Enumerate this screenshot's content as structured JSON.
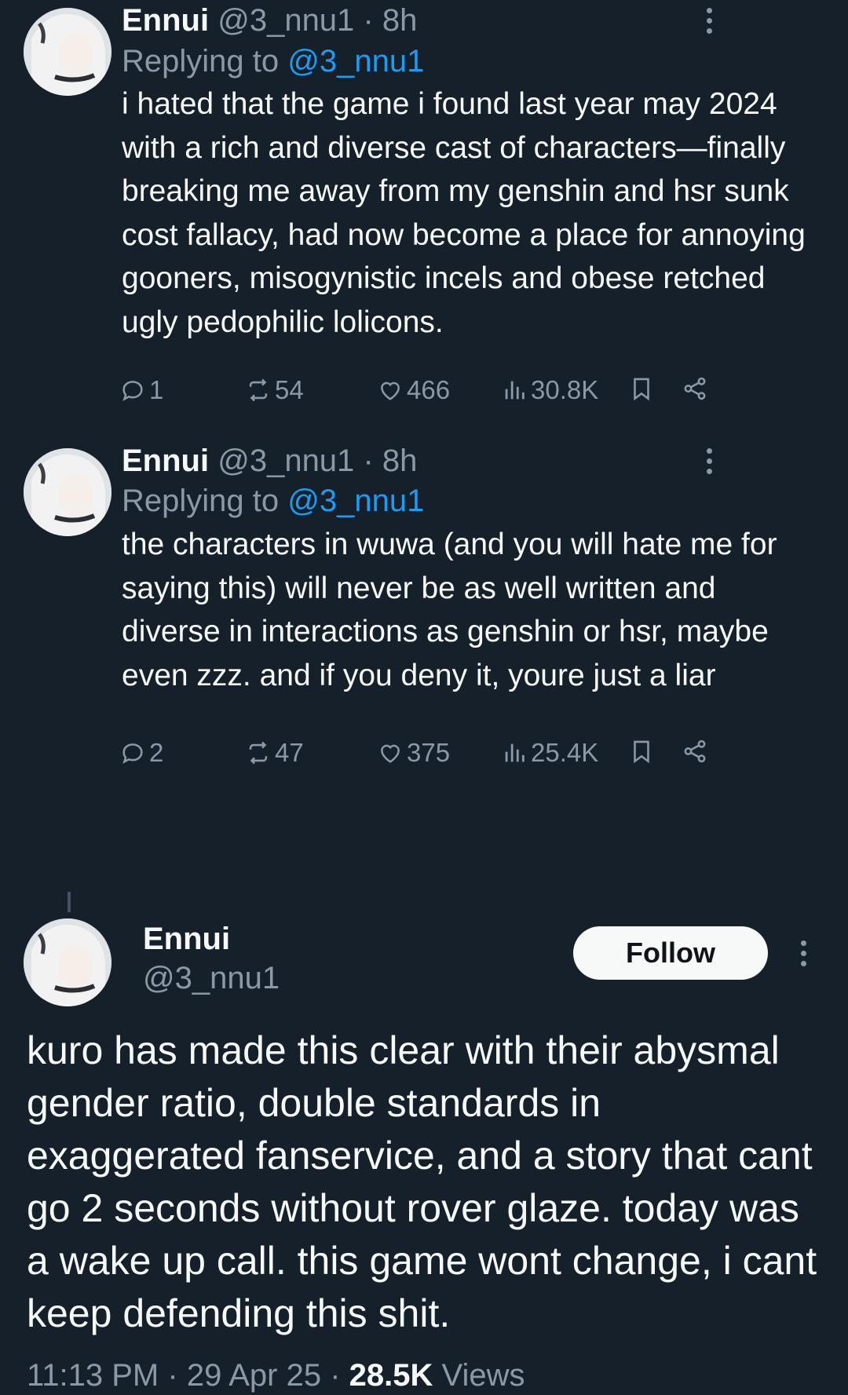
{
  "reply1": {
    "name": "Ennui",
    "handle": "@3_nnu1",
    "dot": "·",
    "time": "8h",
    "replying_prefix": "Replying to ",
    "replying_handle": "@3_nnu1",
    "text": "i hated that the game i found last year may 2024 with a rich and diverse cast of characters—finally breaking me away from my genshin and hsr sunk cost fallacy, had now become a place for annoying gooners, misogynistic incels and obese retched ugly pedophilic lolicons.",
    "replies": "1",
    "reposts": "54",
    "likes": "466",
    "views": "30.8K"
  },
  "reply2": {
    "name": "Ennui",
    "handle": "@3_nnu1",
    "dot": "·",
    "time": "8h",
    "replying_prefix": "Replying to ",
    "replying_handle": "@3_nnu1",
    "text": "the characters in wuwa (and you will hate me for saying this) will never be as well written and diverse in interactions as genshin or hsr, maybe even zzz. and if you deny it, youre just a liar",
    "replies": "2",
    "reposts": "47",
    "likes": "375",
    "views": "25.4K"
  },
  "main_tweet": {
    "name": "Ennui",
    "handle": "@3_nnu1",
    "follow_label": "Follow",
    "text": "kuro has made this clear with their abysmal gender ratio, double standards in exaggerated fanservice, and a story that cant go 2 seconds without rover glaze. today was a wake up call. this game wont change, i cant keep defending this shit.",
    "time": "11:13 PM",
    "date": "29 Apr 25",
    "views_count": "28.5K",
    "views_label": "Views",
    "sep": "·"
  },
  "icons": {
    "reply": "reply-icon",
    "repost": "repost-icon",
    "like": "heart-icon",
    "views": "analytics-icon",
    "bookmark": "bookmark-icon",
    "share": "share-icon",
    "more": "more-icon"
  },
  "colors": {
    "background": "#15202b",
    "text": "#f7f9f9",
    "muted": "#8b98a5",
    "link": "#1d9bf0"
  }
}
